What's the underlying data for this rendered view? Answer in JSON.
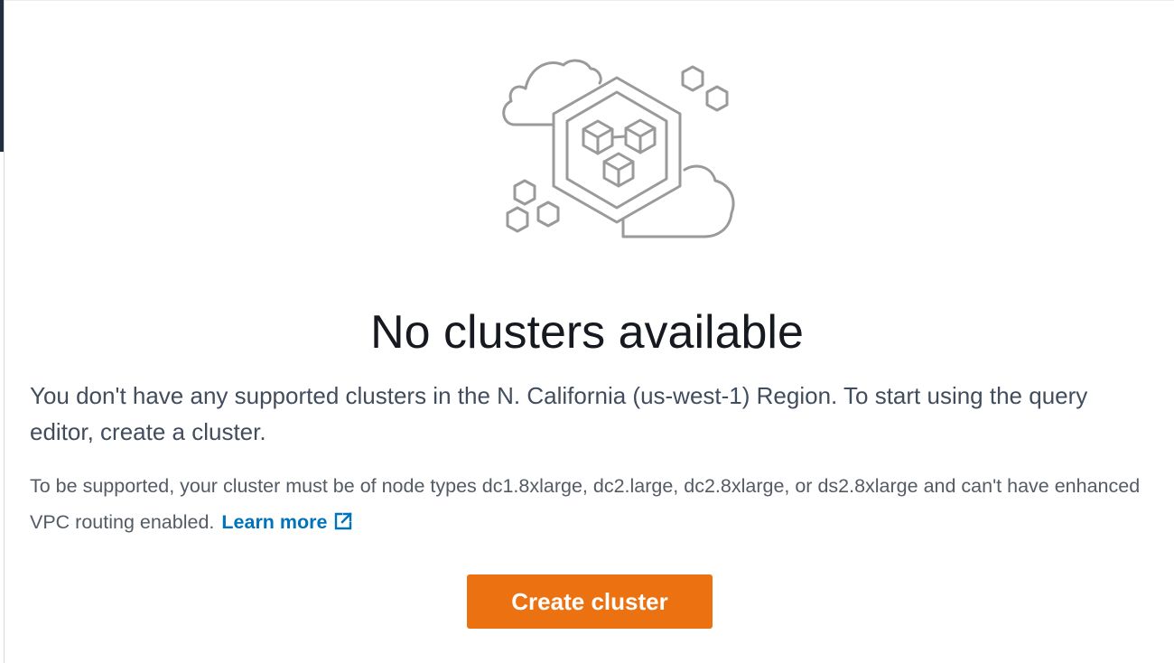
{
  "empty_state": {
    "illustration_icon": "cloud-cluster-illustration",
    "title": "No clusters available",
    "message": "You don't have any supported clusters in the N. California (us-west-1) Region. To start using the query editor, create a cluster.",
    "note": "To be supported, your cluster must be of node types dc1.8xlarge, dc2.large, dc2.8xlarge, or ds2.8xlarge and can't have enhanced VPC routing enabled.",
    "learn_more_label": "Learn more",
    "learn_more_icon": "external-link-icon",
    "create_button_label": "Create cluster"
  },
  "colors": {
    "primary_button": "#ec7211",
    "link": "#0073bb",
    "title_text": "#16191f",
    "body_text": "#414d5c",
    "illustration_stroke": "#9a9a9a"
  }
}
